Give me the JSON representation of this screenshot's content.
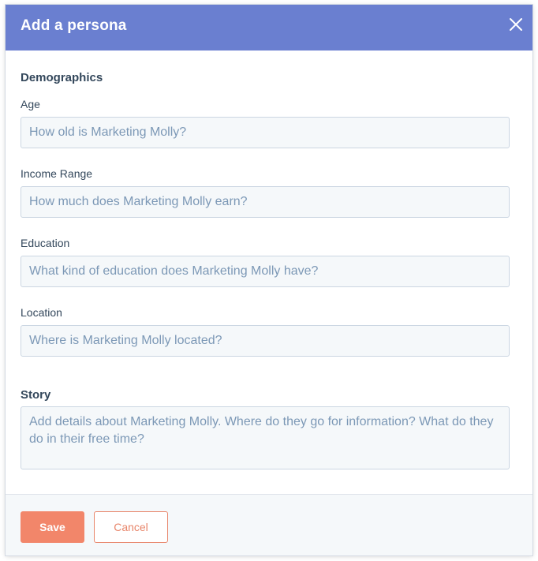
{
  "modal": {
    "title": "Add a persona",
    "close_icon": "close-icon"
  },
  "demographics": {
    "heading": "Demographics",
    "fields": [
      {
        "label": "Age",
        "value": "",
        "placeholder": "How old is Marketing Molly?"
      },
      {
        "label": "Income Range",
        "value": "",
        "placeholder": "How much does Marketing Molly earn?"
      },
      {
        "label": "Education",
        "value": "",
        "placeholder": "What kind of education does Marketing Molly have?"
      },
      {
        "label": "Location",
        "value": "",
        "placeholder": "Where is Marketing Molly located?"
      }
    ]
  },
  "story": {
    "heading": "Story",
    "value": "",
    "placeholder": "Add details about Marketing Molly. Where do they go for information? What do they do in their free time?"
  },
  "footer": {
    "save_label": "Save",
    "cancel_label": "Cancel"
  },
  "colors": {
    "header_bg": "#6a7fd0",
    "primary_button": "#f2866a",
    "text": "#33475b",
    "placeholder": "#7c98b6",
    "input_bg": "#f5f8fa",
    "input_border": "#cbd6e2"
  }
}
